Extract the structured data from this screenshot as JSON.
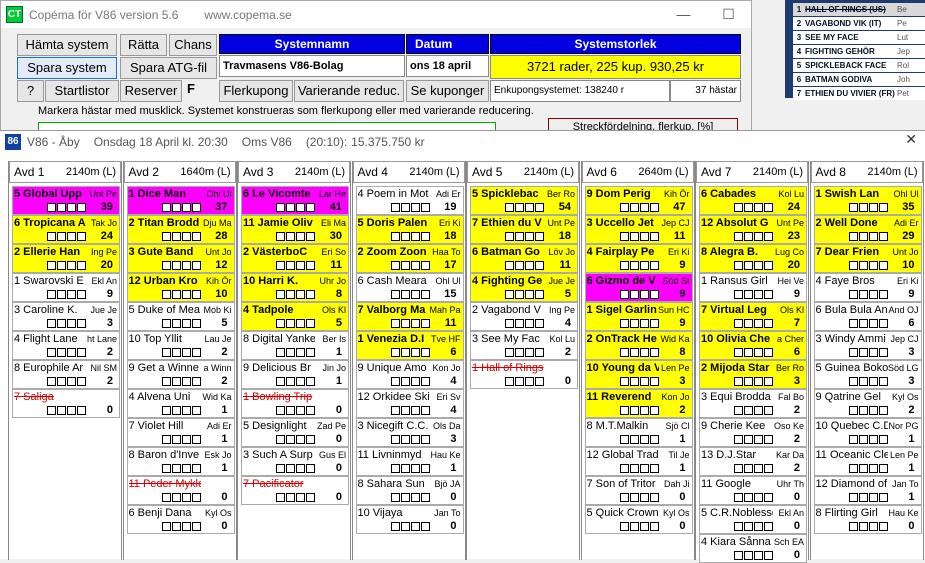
{
  "bg_window": {
    "title": "Copéma för V86  version 5.6",
    "url": "www.copema.se",
    "app_icon": "CT",
    "buttons": {
      "hamta": "Hämta system",
      "ratta": "Rätta",
      "chans": "Chans",
      "spara_system": "Spara system",
      "spara_atg": "Spara ATG-fil",
      "help": "?",
      "startlistor": "Startlistor",
      "reserver": "Reserver",
      "f_letter": "F",
      "flerkupong": "Flerkupong",
      "varierande": "Varierande reduc.",
      "se_kuponger": "Se kuponger"
    },
    "headers": {
      "systemnamn": "Systemnamn",
      "datum": "Datum",
      "systemstorlek": "Systemstorlek"
    },
    "values": {
      "systemnamn": "Travmasens V86-Bolag",
      "datum": "ons 18 april",
      "storlek": "3721 rader, 225 kup.   930,25 kr",
      "enkupong": "Enkupongsystemet: 138240 r",
      "hastar": "37 hästar"
    },
    "hint": "Markera hästar med musklick.    Systemet konstrueras som flerkupong eller med varierande reducering.",
    "streck_btn": "Streckfördelning, flerkup. [%]"
  },
  "right_panel": [
    {
      "num": "1",
      "name": "HALL OF RINGS (US)",
      "extra": "Be",
      "scratched": true
    },
    {
      "num": "2",
      "name": "VAGABOND VIK (IT)",
      "extra": "Pe",
      "scratched": false
    },
    {
      "num": "3",
      "name": "SEE MY FACE",
      "extra": "Lut",
      "scratched": false
    },
    {
      "num": "4",
      "name": "FIGHTING GEHÖR",
      "extra": "Jep",
      "scratched": false
    },
    {
      "num": "5",
      "name": "SPICKLEBACK FACE",
      "extra": "Rol",
      "scratched": false
    },
    {
      "num": "6",
      "name": "BATMAN GODIVA",
      "extra": "Joh",
      "scratched": false
    },
    {
      "num": "7",
      "name": "ETHIEN DU VIVIER (FR)",
      "extra": "Pet",
      "scratched": false
    }
  ],
  "main": {
    "icon": "86",
    "game": "V86 - Åby",
    "date": "Onsdag 18 April kl. 20:30",
    "oms": "Oms V86",
    "time": "(20:10):",
    "amount": "15.375.750 kr",
    "close": "✕"
  },
  "colors": {
    "selected": "#ffff00",
    "top": "#ff00ff",
    "scratched": "#d00000",
    "header_blue": "#0000e0"
  },
  "races": [
    {
      "avd": "Avd 1",
      "dist": "2140m (L)",
      "horses": [
        {
          "name": "5 Global Upp",
          "driver": "Unt Pe",
          "pct": "39",
          "state": "magenta"
        },
        {
          "name": "6 Tropicana A",
          "driver": "Tak Jo",
          "pct": "24",
          "state": "yellow"
        },
        {
          "name": "2 Ellerie Han",
          "driver": "Ing Pe",
          "pct": "20",
          "state": "yellow"
        },
        {
          "name": "1 Swarovski E",
          "driver": "Ekl An",
          "pct": "9",
          "state": "none"
        },
        {
          "name": "3 Caroline K.",
          "driver": "Jue Je",
          "pct": "3",
          "state": "none"
        },
        {
          "name": "4 Flight Lane",
          "driver": "ht Lane",
          "pct": "2",
          "state": "none"
        },
        {
          "name": "8 Europhile Ar",
          "driver": "Nil SM",
          "pct": "2",
          "state": "none"
        },
        {
          "name": "7 Saliga",
          "driver": "",
          "pct": "0",
          "state": "scr"
        }
      ]
    },
    {
      "avd": "Avd 2",
      "dist": "1640m (L)",
      "horses": [
        {
          "name": "1 Dice Man",
          "driver": "Ohl Ul",
          "pct": "37",
          "state": "magenta"
        },
        {
          "name": "2 Titan Brodd",
          "driver": "Dju Ma",
          "pct": "28",
          "state": "yellow"
        },
        {
          "name": "3 Gute Band",
          "driver": "Unt Jo",
          "pct": "12",
          "state": "yellow"
        },
        {
          "name": "12 Urban Kro",
          "driver": "Kih Ör",
          "pct": "10",
          "state": "yellow"
        },
        {
          "name": "5 Duke of Mea",
          "driver": "Mob Ki",
          "pct": "5",
          "state": "none"
        },
        {
          "name": "10 Top Yllit",
          "driver": "Lau Je",
          "pct": "2",
          "state": "none"
        },
        {
          "name": "9 Get a Winne",
          "driver": "a Winn",
          "pct": "2",
          "state": "none"
        },
        {
          "name": "4 Alvena Uni",
          "driver": "Wid Ka",
          "pct": "1",
          "state": "none"
        },
        {
          "name": "7 Violet Hill",
          "driver": "Adi Er",
          "pct": "1",
          "state": "none"
        },
        {
          "name": "8 Baron d'Inve",
          "driver": "Esk Jo",
          "pct": "1",
          "state": "none"
        },
        {
          "name": "11 Peder Mykle",
          "driver": "",
          "pct": "0",
          "state": "scr"
        },
        {
          "name": "6 Benji Dana",
          "driver": "Kyl Os",
          "pct": "0",
          "state": "none"
        }
      ]
    },
    {
      "avd": "Avd 3",
      "dist": "2140m (L)",
      "horses": [
        {
          "name": "6 Le Vicomte",
          "driver": "Lar He",
          "pct": "41",
          "state": "magenta"
        },
        {
          "name": "11 Jamie Oliv",
          "driver": "Eli Ma",
          "pct": "30",
          "state": "yellow"
        },
        {
          "name": "2 VästerboC",
          "driver": "Eri So",
          "pct": "11",
          "state": "yellow"
        },
        {
          "name": "10 Harri K.",
          "driver": "Uhr Jo",
          "pct": "8",
          "state": "yellow"
        },
        {
          "name": "4 Tadpole",
          "driver": "Ols Kl",
          "pct": "5",
          "state": "yellow"
        },
        {
          "name": "8 Digital Yanke",
          "driver": "Ber Is",
          "pct": "1",
          "state": "none"
        },
        {
          "name": "9 Delicious Br",
          "driver": "Jin Jo",
          "pct": "1",
          "state": "none"
        },
        {
          "name": "1 Bowling Trip",
          "driver": "",
          "pct": "0",
          "state": "scr"
        },
        {
          "name": "5 Designlight",
          "driver": "Zad Pe",
          "pct": "0",
          "state": "none"
        },
        {
          "name": "3 Such A Surp",
          "driver": "Gus El",
          "pct": "0",
          "state": "none"
        },
        {
          "name": "7 Pacificator",
          "driver": "",
          "pct": "0",
          "state": "scr"
        }
      ]
    },
    {
      "avd": "Avd 4",
      "dist": "2140m (L)",
      "horses": [
        {
          "name": "4 Poem in Mot",
          "driver": "Adi Er",
          "pct": "19",
          "state": "none"
        },
        {
          "name": "5 Doris Palen",
          "driver": "Eri Ki",
          "pct": "18",
          "state": "yellow"
        },
        {
          "name": "2 Zoom Zoon",
          "driver": "Haa To",
          "pct": "17",
          "state": "yellow"
        },
        {
          "name": "6 Cash Meara",
          "driver": "Ohl Ul",
          "pct": "15",
          "state": "none"
        },
        {
          "name": "7 Valborg Ma",
          "driver": "Mah Pa",
          "pct": "11",
          "state": "yellow"
        },
        {
          "name": "1 Venezia D.I",
          "driver": "Tve HF",
          "pct": "6",
          "state": "yellow"
        },
        {
          "name": "9 Unique Amo",
          "driver": "Kon Jo",
          "pct": "4",
          "state": "none"
        },
        {
          "name": "12 Orkidee Ski",
          "driver": "Eri Sv",
          "pct": "4",
          "state": "none"
        },
        {
          "name": "3 Nicegift C.C.",
          "driver": "Ols Da",
          "pct": "3",
          "state": "none"
        },
        {
          "name": "11 Livninmyd",
          "driver": "Hau Ke",
          "pct": "1",
          "state": "none"
        },
        {
          "name": "8 Sahara Sun",
          "driver": "Bjö JA",
          "pct": "0",
          "state": "none"
        },
        {
          "name": "10 Vijaya",
          "driver": "Jan To",
          "pct": "0",
          "state": "none"
        }
      ]
    },
    {
      "avd": "Avd 5",
      "dist": "2140m (L)",
      "horses": [
        {
          "name": "5 Spicklebac",
          "driver": "Ber Ro",
          "pct": "54",
          "state": "yellow"
        },
        {
          "name": "7 Ethien du V",
          "driver": "Unt Pe",
          "pct": "18",
          "state": "yellow"
        },
        {
          "name": "6 Batman Go",
          "driver": "Löv Jo",
          "pct": "11",
          "state": "yellow"
        },
        {
          "name": "4 Fighting Ge",
          "driver": "Jue Je",
          "pct": "5",
          "state": "yellow"
        },
        {
          "name": "2 Vagabond V",
          "driver": "Ing Pe",
          "pct": "4",
          "state": "none"
        },
        {
          "name": "3 See My Fac",
          "driver": "Kol Lu",
          "pct": "2",
          "state": "none"
        },
        {
          "name": "1 Hall of Rings",
          "driver": "",
          "pct": "0",
          "state": "scr"
        }
      ]
    },
    {
      "avd": "Avd 6",
      "dist": "2640m (L)",
      "horses": [
        {
          "name": "9 Dom Perig",
          "driver": "Kih Ör",
          "pct": "47",
          "state": "yellow"
        },
        {
          "name": "3 Uccello Jet",
          "driver": "Jep CJ",
          "pct": "11",
          "state": "yellow"
        },
        {
          "name": "4 Fairplay Pe",
          "driver": "Eri Ki",
          "pct": "9",
          "state": "yellow"
        },
        {
          "name": "6 Gizmo de V",
          "driver": "Söd St",
          "pct": "9",
          "state": "magenta"
        },
        {
          "name": "1 Sigel Garlin",
          "driver": "Sun HC",
          "pct": "9",
          "state": "yellow"
        },
        {
          "name": "2 OnTrack He",
          "driver": "Wid Ka",
          "pct": "8",
          "state": "yellow"
        },
        {
          "name": "10 Young da V",
          "driver": "Len Pe",
          "pct": "3",
          "state": "yellow"
        },
        {
          "name": "11 Reverend",
          "driver": "Kon Jo",
          "pct": "2",
          "state": "yellow"
        },
        {
          "name": "8 M.T.Malkin",
          "driver": "Sjö Cl",
          "pct": "1",
          "state": "none"
        },
        {
          "name": "12 Global Trad",
          "driver": "Til Je",
          "pct": "1",
          "state": "none"
        },
        {
          "name": "7 Son of Tritor",
          "driver": "Dah Ji",
          "pct": "0",
          "state": "none"
        },
        {
          "name": "5 Quick Crown",
          "driver": "Kyl Os",
          "pct": "0",
          "state": "none"
        }
      ]
    },
    {
      "avd": "Avd 7",
      "dist": "2140m (L)",
      "horses": [
        {
          "name": "6 Cabades",
          "driver": "Kol Lu",
          "pct": "24",
          "state": "yellow"
        },
        {
          "name": "12 Absolut G",
          "driver": "Unt Pe",
          "pct": "23",
          "state": "yellow"
        },
        {
          "name": "8 Alegra B.",
          "driver": "Lug Co",
          "pct": "20",
          "state": "yellow"
        },
        {
          "name": "1 Ransus Girl",
          "driver": "Hei Ve",
          "pct": "9",
          "state": "none"
        },
        {
          "name": "7 Virtual Leg",
          "driver": "Ols Kl",
          "pct": "7",
          "state": "yellow"
        },
        {
          "name": "10 Olivia Che",
          "driver": "a Cher",
          "pct": "6",
          "state": "yellow"
        },
        {
          "name": "2 Mijoda Star",
          "driver": "Ber Ro",
          "pct": "3",
          "state": "yellow"
        },
        {
          "name": "3 Equi Brodda",
          "driver": "Fal Bo",
          "pct": "2",
          "state": "none"
        },
        {
          "name": "9 Cherie Kee",
          "driver": "Oso Ke",
          "pct": "2",
          "state": "none"
        },
        {
          "name": "13 D.J.Star",
          "driver": "Kar Da",
          "pct": "2",
          "state": "none"
        },
        {
          "name": "11 Google",
          "driver": "Uhr Th",
          "pct": "0",
          "state": "none"
        },
        {
          "name": "5 C.R.Noblesse",
          "driver": "Ekl An",
          "pct": "0",
          "state": "none"
        },
        {
          "name": "4 Kiara Sånna",
          "driver": "Sch EA",
          "pct": "0",
          "state": "none"
        }
      ]
    },
    {
      "avd": "Avd 8",
      "dist": "2140m (L)",
      "horses": [
        {
          "name": "1 Swish Lan",
          "driver": "Ohl Ul",
          "pct": "35",
          "state": "yellow"
        },
        {
          "name": "2 Well Done",
          "driver": "Adi Er",
          "pct": "29",
          "state": "yellow"
        },
        {
          "name": "7 Dear Frien",
          "driver": "Unt Jo",
          "pct": "10",
          "state": "yellow"
        },
        {
          "name": "4 Faye Bros",
          "driver": "Eri Ki",
          "pct": "9",
          "state": "none"
        },
        {
          "name": "6 Bula Bula An",
          "driver": "And OJ",
          "pct": "6",
          "state": "none"
        },
        {
          "name": "3 Windy Ammi",
          "driver": "Jep CJ",
          "pct": "3",
          "state": "none"
        },
        {
          "name": "5 Guinea Boko",
          "driver": "Söd LG",
          "pct": "3",
          "state": "none"
        },
        {
          "name": "9 Qatrine Gel",
          "driver": "Kyl Os",
          "pct": "2",
          "state": "none"
        },
        {
          "name": "10 Quebec C.D",
          "driver": "Nor PG",
          "pct": "1",
          "state": "none"
        },
        {
          "name": "11 Oceanic Cle",
          "driver": "Len Pe",
          "pct": "1",
          "state": "none"
        },
        {
          "name": "12 Diamond of",
          "driver": "Jan To",
          "pct": "1",
          "state": "none"
        },
        {
          "name": "8 Flirting Girl",
          "driver": "Hau Ke",
          "pct": "0",
          "state": "none"
        }
      ]
    }
  ]
}
